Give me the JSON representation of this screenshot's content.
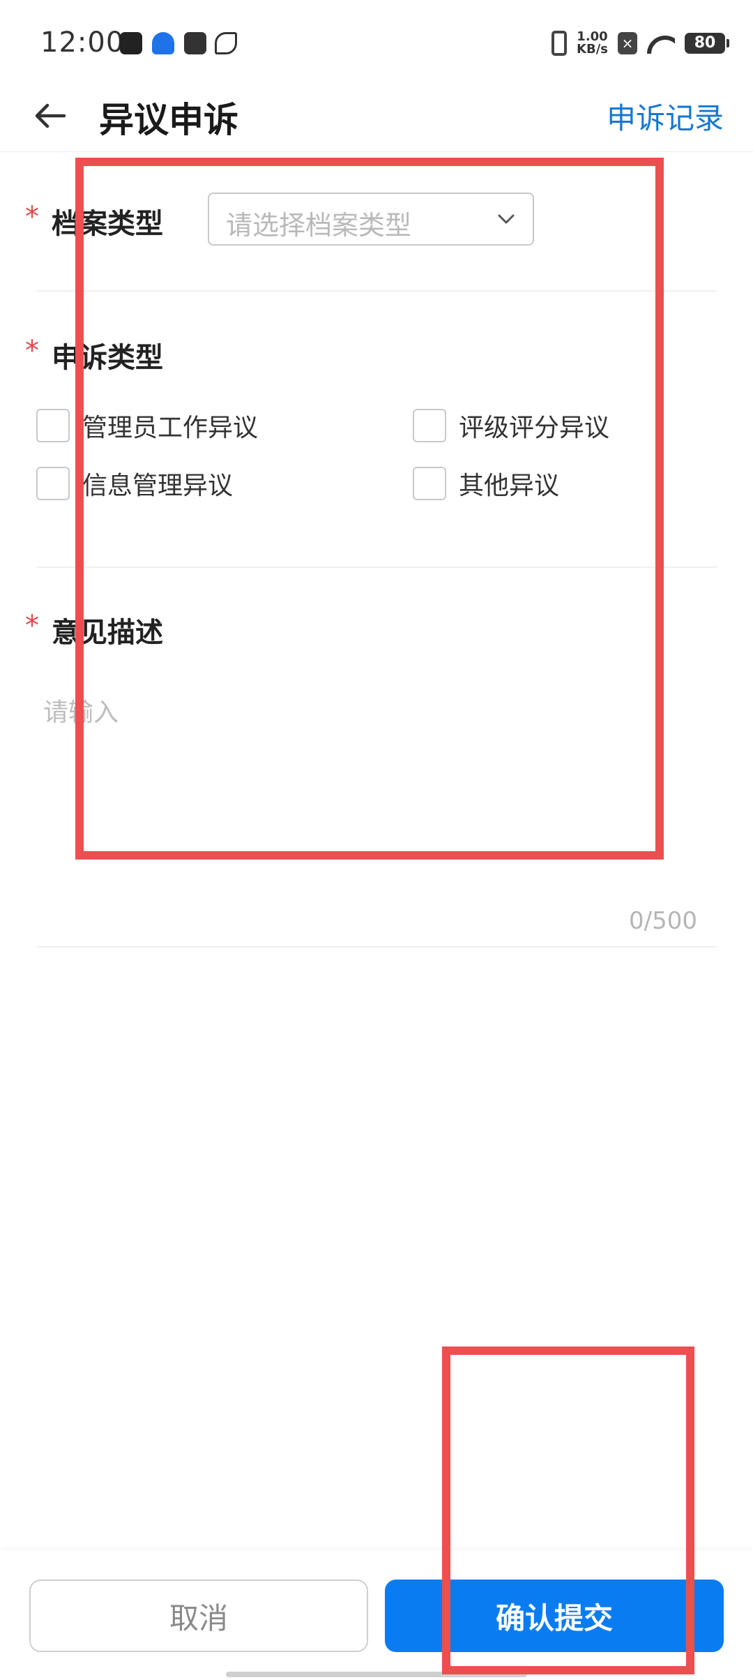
{
  "status_bar": {
    "time": "12:00",
    "speed_value": "1.00",
    "speed_unit": "KB/s",
    "battery": "80",
    "notification_icons": [
      "tiktok-icon",
      "lock-icon",
      "mail-icon",
      "leaf-icon"
    ]
  },
  "header": {
    "title": "异议申诉",
    "records_link": "申诉记录"
  },
  "form": {
    "required_mark": "*",
    "archive_type": {
      "label": "档案类型",
      "placeholder": "请选择档案类型"
    },
    "appeal_type": {
      "label": "申诉类型",
      "options": [
        {
          "label": "管理员工作异议",
          "checked": false
        },
        {
          "label": "评级评分异议",
          "checked": false
        },
        {
          "label": "信息管理异议",
          "checked": false
        },
        {
          "label": "其他异议",
          "checked": false
        }
      ]
    },
    "description": {
      "label": "意见描述",
      "placeholder": "请输入",
      "counter": "0/500"
    }
  },
  "actions": {
    "cancel_label": "取消",
    "submit_label": "确认提交"
  },
  "colors": {
    "accent": "#0a7cf2",
    "link": "#1677d2",
    "required": "#e04a4a",
    "annotation": "#ec4f4f"
  }
}
